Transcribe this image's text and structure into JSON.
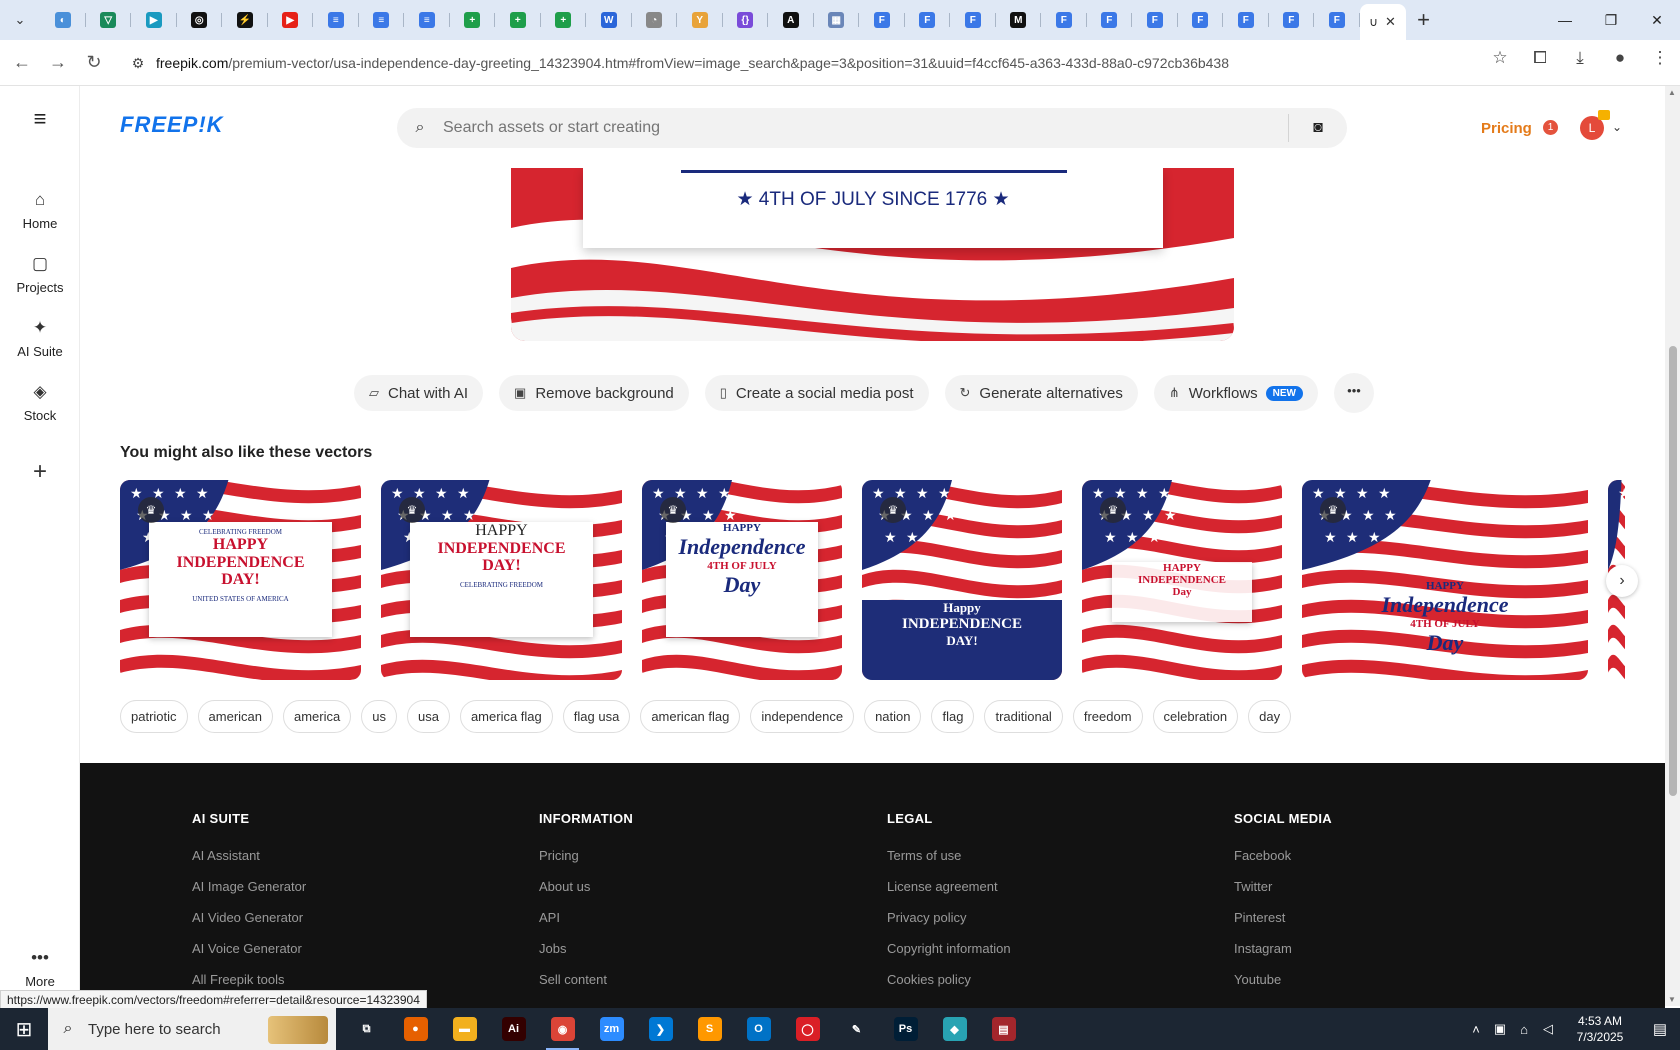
{
  "browser": {
    "tabs": [
      {
        "color": "#4a90d9",
        "glyph": "◐"
      },
      {
        "color": "#1a8a5a",
        "glyph": "▽"
      },
      {
        "color": "#1a9ac0",
        "glyph": "▶"
      },
      {
        "color": "#111111",
        "glyph": "◎"
      },
      {
        "color": "#111111",
        "glyph": "⚡"
      },
      {
        "color": "#e62117",
        "glyph": "▶"
      },
      {
        "color": "#3b78e7",
        "glyph": "≡"
      },
      {
        "color": "#3b78e7",
        "glyph": "≡"
      },
      {
        "color": "#3b78e7",
        "glyph": "≡"
      },
      {
        "color": "#1e9e4a",
        "glyph": "+"
      },
      {
        "color": "#1e9e4a",
        "glyph": "+"
      },
      {
        "color": "#1e9e4a",
        "glyph": "+"
      },
      {
        "color": "#2b66d9",
        "glyph": "W"
      },
      {
        "color": "#888888",
        "glyph": "◔"
      },
      {
        "color": "#e8a33a",
        "glyph": "Y"
      },
      {
        "color": "#7a4bd9",
        "glyph": "{}"
      },
      {
        "color": "#111111",
        "glyph": "A"
      },
      {
        "color": "#6a86b8",
        "glyph": "▦"
      },
      {
        "color": "#3b78e7",
        "glyph": "F"
      },
      {
        "color": "#3b78e7",
        "glyph": "F"
      },
      {
        "color": "#3b78e7",
        "glyph": "F"
      },
      {
        "color": "#111111",
        "glyph": "M"
      },
      {
        "color": "#3b78e7",
        "glyph": "F"
      },
      {
        "color": "#3b78e7",
        "glyph": "F"
      },
      {
        "color": "#3b78e7",
        "glyph": "F"
      },
      {
        "color": "#3b78e7",
        "glyph": "F"
      },
      {
        "color": "#3b78e7",
        "glyph": "F"
      },
      {
        "color": "#3b78e7",
        "glyph": "F"
      },
      {
        "color": "#3b78e7",
        "glyph": "F"
      }
    ],
    "url_domain": "freepik.com",
    "url_path": "/premium-vector/usa-independence-day-greeting_14323904.htm#fromView=image_search&page=3&position=31&uuid=f4ccf645-a363-433d-88a0-c972cb36b438"
  },
  "sidebar": {
    "items": [
      {
        "label": "Home",
        "icon": "home-icon",
        "glyph": "⌂"
      },
      {
        "label": "Projects",
        "icon": "projects-icon",
        "glyph": "▢"
      },
      {
        "label": "AI Suite",
        "icon": "ai-suite-icon",
        "glyph": "✦"
      },
      {
        "label": "Stock",
        "icon": "stock-icon",
        "glyph": "◈"
      }
    ],
    "add_glyph": "+",
    "more_label": "More"
  },
  "header": {
    "logo": "FREEP!K",
    "search_placeholder": "Search assets or start creating",
    "pricing_label": "Pricing",
    "notification_count": "1",
    "accent": "#1273eb",
    "pricing_color": "#e47b1a"
  },
  "hero": {
    "banner_text": "4TH OF JULY SINCE 1776"
  },
  "actions": [
    {
      "label": "Chat with AI",
      "icon": "chat-icon",
      "glyph": "▱"
    },
    {
      "label": "Remove background",
      "icon": "remove-bg-icon",
      "glyph": "▣"
    },
    {
      "label": "Create a social media post",
      "icon": "phone-icon",
      "glyph": "▯"
    },
    {
      "label": "Generate alternatives",
      "icon": "refresh-icon",
      "glyph": "↻"
    },
    {
      "label": "Workflows",
      "icon": "workflow-icon",
      "glyph": "⋔",
      "badge": "NEW"
    }
  ],
  "similar": {
    "title": "You might also like these vectors",
    "thumbnails": [
      {
        "lines": [
          "CELEBRATING FREEDOM",
          "HAPPY",
          "INDEPENDENCE",
          "DAY!",
          "UNITED STATES OF AMERICA"
        ]
      },
      {
        "lines": [
          "HAPPY",
          "INDEPENDENCE",
          "DAY!",
          "CELEBRATING FREEDOM"
        ]
      },
      {
        "lines": [
          "HAPPY",
          "Independence",
          "4TH OF JULY",
          "Day"
        ]
      },
      {
        "lines": [
          "Happy",
          "INDEPENDENCE",
          "DAY!"
        ]
      },
      {
        "lines": [
          "HAPPY",
          "INDEPENDENCE",
          "Day"
        ]
      },
      {
        "lines": [
          "HAPPY",
          "Independence",
          "4TH OF JULY",
          "Day"
        ]
      }
    ]
  },
  "tags": [
    "patriotic",
    "american",
    "america",
    "us",
    "usa",
    "america flag",
    "flag usa",
    "american flag",
    "independence",
    "nation",
    "flag",
    "traditional",
    "freedom",
    "celebration",
    "day"
  ],
  "footer": {
    "columns": [
      {
        "title": "AI SUITE",
        "links": [
          "AI Assistant",
          "AI Image Generator",
          "AI Video Generator",
          "AI Voice Generator",
          "All Freepik tools"
        ]
      },
      {
        "title": "INFORMATION",
        "links": [
          "Pricing",
          "About us",
          "API",
          "Jobs",
          "Sell content"
        ]
      },
      {
        "title": "LEGAL",
        "links": [
          "Terms of use",
          "License agreement",
          "Privacy policy",
          "Copyright information",
          "Cookies policy"
        ]
      },
      {
        "title": "SOCIAL MEDIA",
        "links": [
          "Facebook",
          "Twitter",
          "Pinterest",
          "Instagram",
          "Youtube"
        ]
      }
    ]
  },
  "status_url": "https://www.freepik.com/vectors/freedom#referrer=detail&resource=14323904",
  "taskbar": {
    "search_placeholder": "Type here to search",
    "apps": [
      {
        "name": "task-view",
        "color": "transparent",
        "glyph": "⧉"
      },
      {
        "name": "firefox",
        "color": "#e66000",
        "glyph": "●"
      },
      {
        "name": "file-explorer",
        "color": "#f2b01e",
        "glyph": "▬"
      },
      {
        "name": "illustrator",
        "color": "#330000",
        "glyph": "Ai"
      },
      {
        "name": "chrome",
        "color": "#db4437",
        "glyph": "◉"
      },
      {
        "name": "zoom",
        "color": "#2d8cff",
        "glyph": "zm"
      },
      {
        "name": "vscode",
        "color": "#0078d4",
        "glyph": "❯"
      },
      {
        "name": "sublime",
        "color": "#ff9800",
        "glyph": "S"
      },
      {
        "name": "outlook",
        "color": "#0072c6",
        "glyph": "O"
      },
      {
        "name": "creative-cloud",
        "color": "#da1f26",
        "glyph": "◯"
      },
      {
        "name": "pen-tool",
        "color": "transparent",
        "glyph": "✎"
      },
      {
        "name": "photoshop",
        "color": "#001e36",
        "glyph": "Ps"
      },
      {
        "name": "sketch-app",
        "color": "#28a3b3",
        "glyph": "◆"
      },
      {
        "name": "archive",
        "color": "#a3262c",
        "glyph": "▤"
      }
    ],
    "time": "4:53 AM",
    "date": "7/3/2025"
  }
}
